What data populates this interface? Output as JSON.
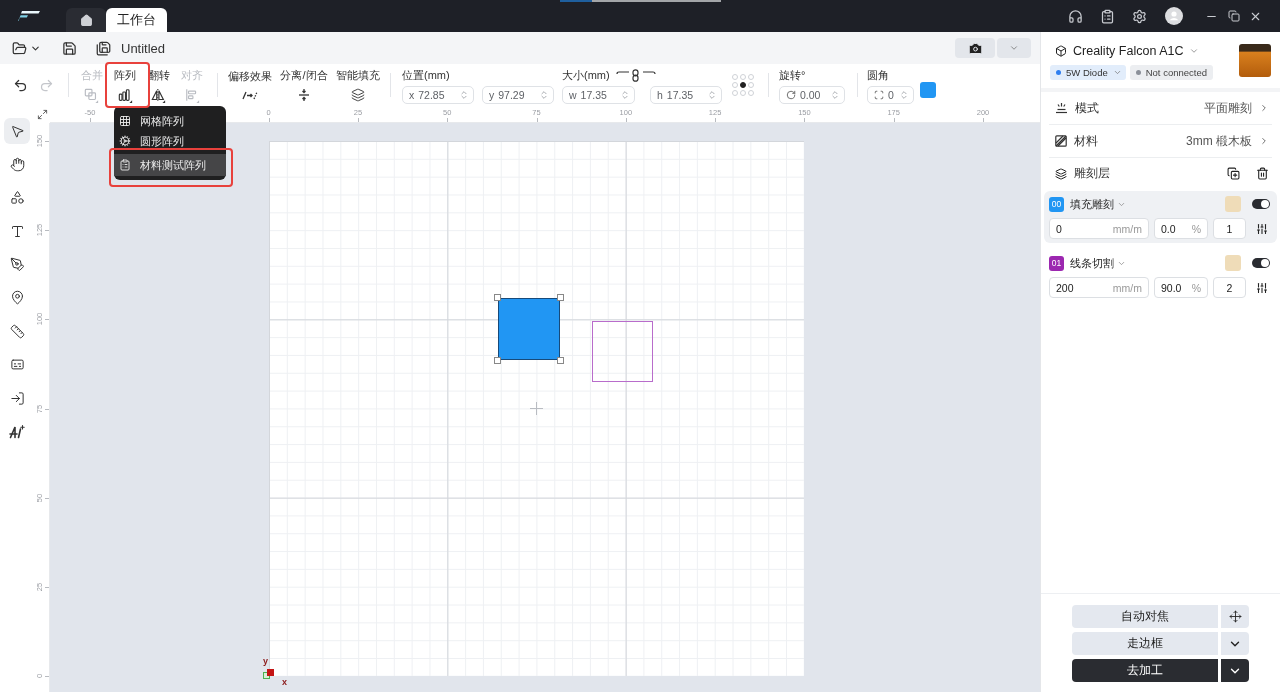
{
  "title_bar": {
    "tabs": [
      {
        "kind": "home",
        "selected": false
      },
      {
        "kind": "text",
        "label": "工作台",
        "selected": true
      }
    ],
    "progress": {
      "level": 0.2
    }
  },
  "file_bar": {
    "document_title": "Untitled"
  },
  "toolbar": {
    "undo": {
      "disabled": false
    },
    "redo": {
      "disabled": true
    },
    "tools": [
      {
        "label": "合并",
        "disabled": true,
        "outlined": false,
        "expanded": false
      },
      {
        "label": "阵列",
        "disabled": false,
        "outlined": true,
        "expanded": true
      },
      {
        "label": "翻转",
        "disabled": false,
        "outlined": false,
        "expanded": false
      },
      {
        "label": "对齐",
        "disabled": true,
        "outlined": false,
        "expanded": false
      }
    ],
    "effects": [
      {
        "label": "偏移效果"
      },
      {
        "label": "分离/闭合"
      },
      {
        "label": "智能填充"
      }
    ],
    "position": {
      "label": "位置(mm)",
      "fields": [
        {
          "prefix": "x",
          "value": "72.85"
        },
        {
          "prefix": "y",
          "value": "97.29"
        }
      ]
    },
    "size": {
      "label": "大小(mm)",
      "fields": [
        {
          "prefix": "w",
          "value": "17.35"
        },
        {
          "prefix": "h",
          "value": "17.35"
        }
      ]
    },
    "anchor_points": [
      {
        "selected": false
      },
      {
        "selected": false
      },
      {
        "selected": false
      },
      {
        "selected": false
      },
      {
        "selected": true
      },
      {
        "selected": false
      },
      {
        "selected": false
      },
      {
        "selected": false
      },
      {
        "selected": false
      }
    ],
    "rotation": {
      "label": "旋转°",
      "value": "0.00"
    },
    "corner_radius": {
      "label": "圆角",
      "value": "0"
    }
  },
  "array_menu": {
    "items": [
      {
        "label": "网格阵列",
        "selected": false,
        "outlined": false
      },
      {
        "label": "圆形阵列",
        "selected": false,
        "outlined": false
      },
      {
        "label": "材料测试阵列",
        "selected": true,
        "outlined": true
      }
    ]
  },
  "tool_sidebar": {
    "tools": [
      {
        "selected": true
      },
      {
        "selected": false
      },
      {
        "selected": false
      },
      {
        "selected": false
      },
      {
        "selected": false
      },
      {
        "selected": false
      },
      {
        "selected": false
      },
      {
        "selected": false
      },
      {
        "selected": false
      },
      {
        "selected": false
      }
    ]
  },
  "rulers": {
    "x_labels": [
      "-50",
      "0",
      "25",
      "50",
      "75",
      "100",
      "125",
      "150",
      "175",
      "200"
    ],
    "y_labels": [
      "150",
      "125",
      "100",
      "75",
      "50",
      "25",
      "0"
    ]
  },
  "canvas": {
    "shapes": [
      {
        "kind": "filled",
        "selected": true,
        "color": "#2196f3"
      },
      {
        "kind": "outline",
        "selected": false,
        "color": "#b86ccb"
      }
    ],
    "origin": {
      "y_label": "y",
      "x_label": "x"
    }
  },
  "device": {
    "name": "Creality Falcon A1C",
    "laser": "5W Diode",
    "status": "Not connected",
    "connected": false
  },
  "settings": [
    {
      "label": "模式",
      "value": "平面雕刻"
    },
    {
      "label": "材料",
      "value": "3mm 椴木板"
    }
  ],
  "layers_section": {
    "title": "雕刻层"
  },
  "layers": [
    {
      "number": "00",
      "name": "填充雕刻",
      "color": "#2196f3",
      "selected": true,
      "enabled": true,
      "speed": "0",
      "speed_unit": "mm/m",
      "power": "0.0",
      "power_unit": "%",
      "passes": "1"
    },
    {
      "number": "01",
      "name": "线条切割",
      "color": "#9c27b0",
      "selected": false,
      "enabled": true,
      "speed": "200",
      "speed_unit": "mm/m",
      "power": "90.0",
      "power_unit": "%",
      "passes": "2"
    }
  ],
  "actions": [
    {
      "label": "自动对焦",
      "kind": "secondary"
    },
    {
      "label": "走边框",
      "kind": "secondary"
    },
    {
      "label": "去加工",
      "kind": "primary"
    }
  ]
}
